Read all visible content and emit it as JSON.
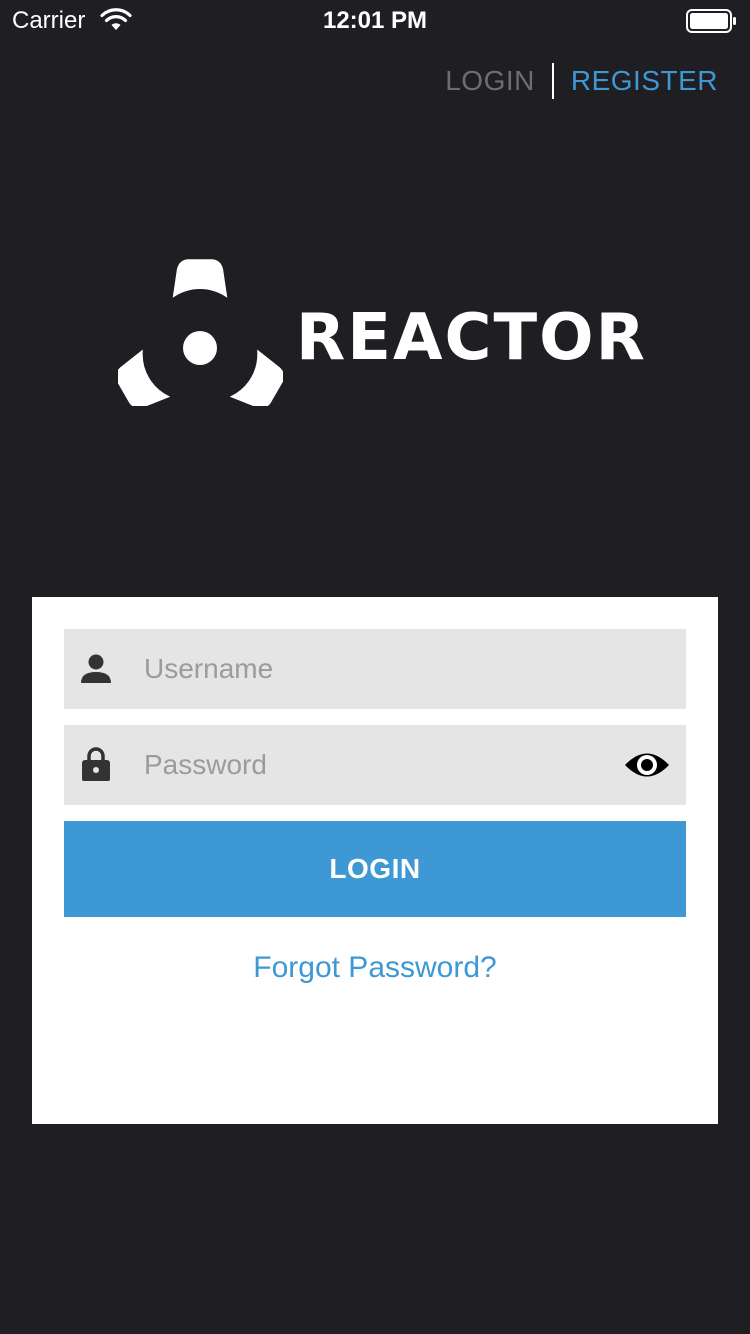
{
  "status_bar": {
    "carrier": "Carrier",
    "time": "12:01 PM",
    "icons": [
      "wifi-icon",
      "battery-icon"
    ]
  },
  "nav": {
    "login_label": "LOGIN",
    "register_label": "REGISTER"
  },
  "logo": {
    "text": "REACTOR",
    "icon": "reactor-logo-icon"
  },
  "form": {
    "username": {
      "value": "",
      "placeholder": "Username",
      "icon": "user-icon"
    },
    "password": {
      "value": "",
      "placeholder": "Password",
      "icon": "lock-icon",
      "toggle_icon": "eye-icon"
    },
    "submit_label": "LOGIN",
    "forgot_label": "Forgot Password?"
  },
  "colors": {
    "background": "#1f1e22",
    "accent": "#3d98d4",
    "muted": "#6e6d72",
    "field_bg": "#e5e5e5",
    "card_bg": "#ffffff"
  }
}
